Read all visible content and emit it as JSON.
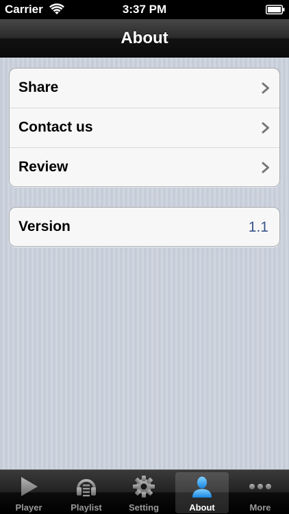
{
  "status_bar": {
    "carrier": "Carrier",
    "time": "3:37 PM",
    "wifi_icon": "wifi-icon",
    "battery_icon": "battery-icon"
  },
  "nav_bar": {
    "title": "About"
  },
  "groups": [
    {
      "rows": [
        {
          "label": "Share",
          "accessory": "chevron-right-icon"
        },
        {
          "label": "Contact us",
          "accessory": "chevron-right-icon"
        },
        {
          "label": "Review",
          "accessory": "chevron-right-icon"
        }
      ]
    },
    {
      "rows": [
        {
          "label": "Version",
          "value": "1.1"
        }
      ]
    }
  ],
  "tab_bar": {
    "tabs": [
      {
        "label": "Player",
        "icon": "play-icon",
        "active": false
      },
      {
        "label": "Playlist",
        "icon": "playlist-icon",
        "active": false
      },
      {
        "label": "Setting",
        "icon": "gear-icon",
        "active": false
      },
      {
        "label": "About",
        "icon": "person-icon",
        "active": true
      },
      {
        "label": "More",
        "icon": "more-icon",
        "active": false
      }
    ]
  },
  "colors": {
    "value_text": "#385487",
    "active_tab_icon": "#37a7f4",
    "inactive_tab": "#9a9a9a"
  }
}
